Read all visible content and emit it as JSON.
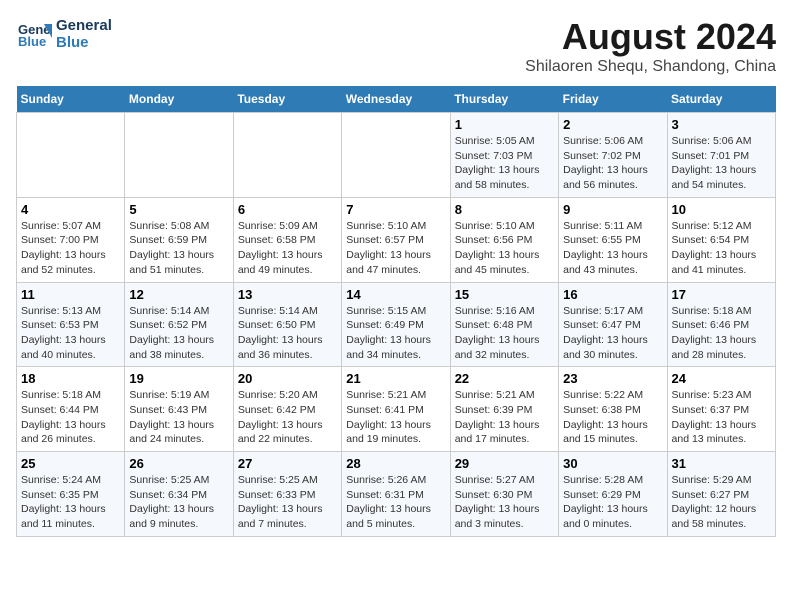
{
  "logo": {
    "line1": "General",
    "line2": "Blue"
  },
  "title": "August 2024",
  "subtitle": "Shilaoren Shequ, Shandong, China",
  "days_of_week": [
    "Sunday",
    "Monday",
    "Tuesday",
    "Wednesday",
    "Thursday",
    "Friday",
    "Saturday"
  ],
  "weeks": [
    [
      {
        "num": "",
        "info": ""
      },
      {
        "num": "",
        "info": ""
      },
      {
        "num": "",
        "info": ""
      },
      {
        "num": "",
        "info": ""
      },
      {
        "num": "1",
        "info": "Sunrise: 5:05 AM\nSunset: 7:03 PM\nDaylight: 13 hours and 58 minutes."
      },
      {
        "num": "2",
        "info": "Sunrise: 5:06 AM\nSunset: 7:02 PM\nDaylight: 13 hours and 56 minutes."
      },
      {
        "num": "3",
        "info": "Sunrise: 5:06 AM\nSunset: 7:01 PM\nDaylight: 13 hours and 54 minutes."
      }
    ],
    [
      {
        "num": "4",
        "info": "Sunrise: 5:07 AM\nSunset: 7:00 PM\nDaylight: 13 hours and 52 minutes."
      },
      {
        "num": "5",
        "info": "Sunrise: 5:08 AM\nSunset: 6:59 PM\nDaylight: 13 hours and 51 minutes."
      },
      {
        "num": "6",
        "info": "Sunrise: 5:09 AM\nSunset: 6:58 PM\nDaylight: 13 hours and 49 minutes."
      },
      {
        "num": "7",
        "info": "Sunrise: 5:10 AM\nSunset: 6:57 PM\nDaylight: 13 hours and 47 minutes."
      },
      {
        "num": "8",
        "info": "Sunrise: 5:10 AM\nSunset: 6:56 PM\nDaylight: 13 hours and 45 minutes."
      },
      {
        "num": "9",
        "info": "Sunrise: 5:11 AM\nSunset: 6:55 PM\nDaylight: 13 hours and 43 minutes."
      },
      {
        "num": "10",
        "info": "Sunrise: 5:12 AM\nSunset: 6:54 PM\nDaylight: 13 hours and 41 minutes."
      }
    ],
    [
      {
        "num": "11",
        "info": "Sunrise: 5:13 AM\nSunset: 6:53 PM\nDaylight: 13 hours and 40 minutes."
      },
      {
        "num": "12",
        "info": "Sunrise: 5:14 AM\nSunset: 6:52 PM\nDaylight: 13 hours and 38 minutes."
      },
      {
        "num": "13",
        "info": "Sunrise: 5:14 AM\nSunset: 6:50 PM\nDaylight: 13 hours and 36 minutes."
      },
      {
        "num": "14",
        "info": "Sunrise: 5:15 AM\nSunset: 6:49 PM\nDaylight: 13 hours and 34 minutes."
      },
      {
        "num": "15",
        "info": "Sunrise: 5:16 AM\nSunset: 6:48 PM\nDaylight: 13 hours and 32 minutes."
      },
      {
        "num": "16",
        "info": "Sunrise: 5:17 AM\nSunset: 6:47 PM\nDaylight: 13 hours and 30 minutes."
      },
      {
        "num": "17",
        "info": "Sunrise: 5:18 AM\nSunset: 6:46 PM\nDaylight: 13 hours and 28 minutes."
      }
    ],
    [
      {
        "num": "18",
        "info": "Sunrise: 5:18 AM\nSunset: 6:44 PM\nDaylight: 13 hours and 26 minutes."
      },
      {
        "num": "19",
        "info": "Sunrise: 5:19 AM\nSunset: 6:43 PM\nDaylight: 13 hours and 24 minutes."
      },
      {
        "num": "20",
        "info": "Sunrise: 5:20 AM\nSunset: 6:42 PM\nDaylight: 13 hours and 22 minutes."
      },
      {
        "num": "21",
        "info": "Sunrise: 5:21 AM\nSunset: 6:41 PM\nDaylight: 13 hours and 19 minutes."
      },
      {
        "num": "22",
        "info": "Sunrise: 5:21 AM\nSunset: 6:39 PM\nDaylight: 13 hours and 17 minutes."
      },
      {
        "num": "23",
        "info": "Sunrise: 5:22 AM\nSunset: 6:38 PM\nDaylight: 13 hours and 15 minutes."
      },
      {
        "num": "24",
        "info": "Sunrise: 5:23 AM\nSunset: 6:37 PM\nDaylight: 13 hours and 13 minutes."
      }
    ],
    [
      {
        "num": "25",
        "info": "Sunrise: 5:24 AM\nSunset: 6:35 PM\nDaylight: 13 hours and 11 minutes."
      },
      {
        "num": "26",
        "info": "Sunrise: 5:25 AM\nSunset: 6:34 PM\nDaylight: 13 hours and 9 minutes."
      },
      {
        "num": "27",
        "info": "Sunrise: 5:25 AM\nSunset: 6:33 PM\nDaylight: 13 hours and 7 minutes."
      },
      {
        "num": "28",
        "info": "Sunrise: 5:26 AM\nSunset: 6:31 PM\nDaylight: 13 hours and 5 minutes."
      },
      {
        "num": "29",
        "info": "Sunrise: 5:27 AM\nSunset: 6:30 PM\nDaylight: 13 hours and 3 minutes."
      },
      {
        "num": "30",
        "info": "Sunrise: 5:28 AM\nSunset: 6:29 PM\nDaylight: 13 hours and 0 minutes."
      },
      {
        "num": "31",
        "info": "Sunrise: 5:29 AM\nSunset: 6:27 PM\nDaylight: 12 hours and 58 minutes."
      }
    ]
  ]
}
